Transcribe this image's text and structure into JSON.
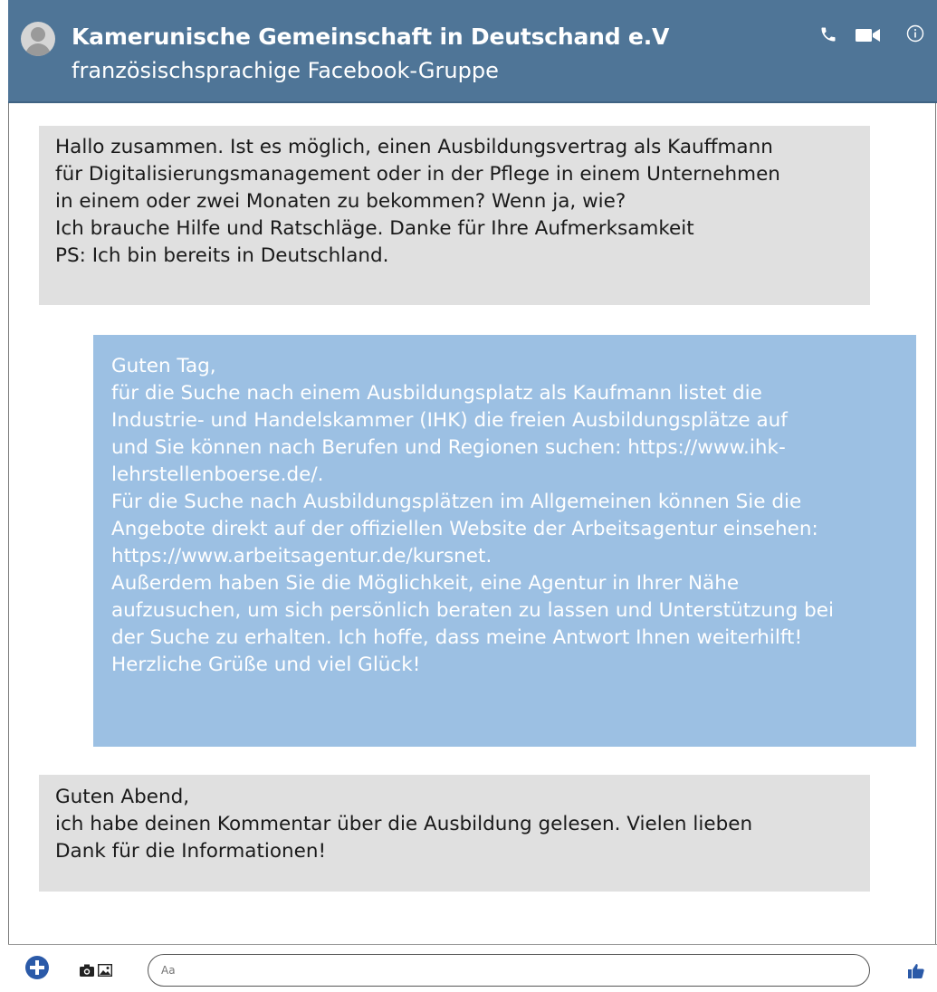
{
  "conversation": {
    "title": "Kamerunische Gemeinschaft in Deutschand e.V",
    "subtitle": "französischsprachige Facebook-Gruppe"
  },
  "header_icons": [
    "phone-icon",
    "video-camera-icon",
    "info-icon"
  ],
  "messages": [
    {
      "direction": "incoming",
      "text": "Hallo zusammen. Ist es möglich, einen Ausbildungsvertrag als Kauffmann\nfür Digitalisierungsmanagement oder in der Pflege in einem Unternehmen\nin einem oder zwei Monaten zu bekommen? Wenn ja, wie?\nIch brauche Hilfe und Ratschläge. Danke für Ihre Aufmerksamkeit\nPS: Ich bin bereits in Deutschland."
    },
    {
      "direction": "outgoing",
      "text": "Guten Tag,\nfür die Suche nach einem Ausbildungsplatz als Kaufmann listet die\nIndustrie- und Handelskammer (IHK) die freien Ausbildungsplätze auf\nund Sie können nach Berufen und Regionen suchen: https://www.ihk-\nlehrstellenboerse.de/.\nFür die Suche nach Ausbildungsplätzen im Allgemeinen können Sie die\nAngebote direkt auf der offiziellen Website der Arbeitsagentur einsehen:\nhttps://www.arbeitsagentur.de/kursnet.\nAußerdem haben Sie die Möglichkeit, eine Agentur in Ihrer Nähe\naufzusuchen, um sich persönlich beraten zu lassen und Unterstützung bei\nder Suche zu erhalten. Ich hoffe, dass meine Antwort Ihnen weiterhilft!\nHerzliche Grüße und viel Glück!"
    },
    {
      "direction": "incoming",
      "text": "Guten Abend,\nich habe deinen Kommentar über die Ausbildung gelesen. Vielen lieben\nDank für die Informationen!"
    }
  ],
  "composer": {
    "placeholder": "Aa"
  },
  "footer_icons": [
    "add-icon",
    "camera-icon",
    "image-icon",
    "thumbs-up-icon"
  ],
  "colors": {
    "header_bg": "#4f7597",
    "incoming_bubble": "#e0e0e0",
    "outgoing_bubble": "#9cc0e3",
    "accent": "#2b5aa8"
  }
}
